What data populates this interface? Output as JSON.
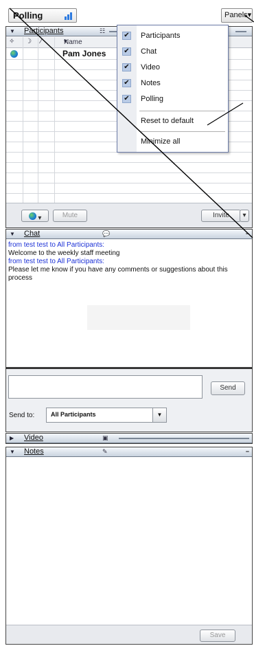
{
  "topbar": {
    "polling_label": "Polling",
    "panels_label": "Panels"
  },
  "participants": {
    "title": "Participants",
    "columns": {
      "name": "Name"
    },
    "rows": [
      {
        "name": "Pam Jones"
      }
    ],
    "mute_label": "Mute",
    "invite_label": "Invite"
  },
  "menu": {
    "items": [
      {
        "label": "Participants",
        "checked": true
      },
      {
        "label": "Chat",
        "checked": true
      },
      {
        "label": "Video",
        "checked": true
      },
      {
        "label": "Notes",
        "checked": true
      },
      {
        "label": "Polling",
        "checked": true
      }
    ],
    "reset_label": "Reset to default",
    "minimize_label": "Minimize all"
  },
  "chat": {
    "title": "Chat",
    "messages": [
      {
        "from": "from test test to All Participants:",
        "text": "Welcome to the weekly staff meeting"
      },
      {
        "from": "from test test to All Participants:",
        "text": "Please let me know if you have any comments or suggestions about this process"
      }
    ],
    "send_label": "Send",
    "send_to_label": "Send to:",
    "send_to_value": "All Participants"
  },
  "video": {
    "title": "Video"
  },
  "notes": {
    "title": "Notes",
    "save_label": "Save"
  },
  "colors": {
    "header_blue": "#c9d3df",
    "message_from": "#1a2fd6",
    "menu_check": "#b9cbe6"
  }
}
